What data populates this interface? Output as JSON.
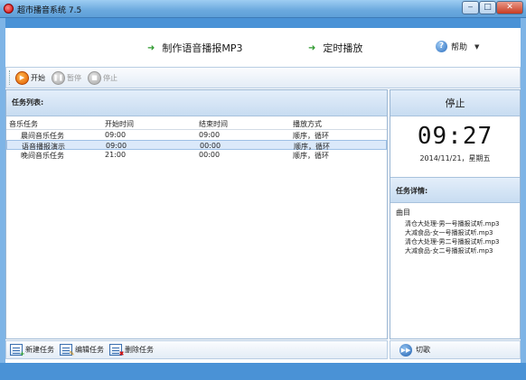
{
  "window": {
    "title": "超市播音系统 7.5",
    "minimize_glyph": "‒",
    "maximize_glyph": "□",
    "close_glyph": "✕"
  },
  "nav": {
    "make_mp3": "制作语音播报MP3",
    "timer_play": "定时播放",
    "help": "帮助",
    "help_icon": "?",
    "arrow_glyph": "➜",
    "caret_glyph": "▼"
  },
  "toolbar": {
    "start": "开始",
    "pause": "暂停",
    "stop": "停止",
    "start_glyph": "▶",
    "pause_glyph": "❚❚",
    "stop_glyph": "■"
  },
  "task_list": {
    "title": "任务列表:",
    "columns": [
      "音乐任务",
      "开始时间",
      "结束时间",
      "播放方式"
    ],
    "rows": [
      [
        "晨间音乐任务",
        "09:00",
        "09:00",
        "顺序，循环"
      ],
      [
        "语音播报演示",
        "09:00",
        "00:00",
        "顺序，循环"
      ],
      [
        "晚间音乐任务",
        "21:00",
        "00:00",
        "顺序，循环"
      ]
    ],
    "selected_row": 1
  },
  "status": {
    "state": "停止",
    "clock": "09:27",
    "date": "2014/11/21，星期五"
  },
  "details": {
    "title": "任务详情:",
    "column": "曲目",
    "tracks": [
      "清仓大处理-男一号播报试听.mp3",
      "大减食品-女一号播报试听.mp3",
      "清仓大处理-男二号播报试听.mp3",
      "大减食品-女二号播报试听.mp3"
    ]
  },
  "bottom": {
    "new_task": "新建任务",
    "edit_task": "编辑任务",
    "delete_task": "删除任务",
    "switch": "切歌",
    "add_glyph": "+",
    "edit_glyph": "✎",
    "delete_glyph": "✖",
    "switch_glyph": "▶▶"
  },
  "colors": {
    "title_bar": "#6ba9de",
    "accent_blue": "#4a92d6",
    "start_orange": "#e25d00",
    "nav_arrow_green": "#2f9a2f",
    "selected_row": "#dbe9fa"
  }
}
